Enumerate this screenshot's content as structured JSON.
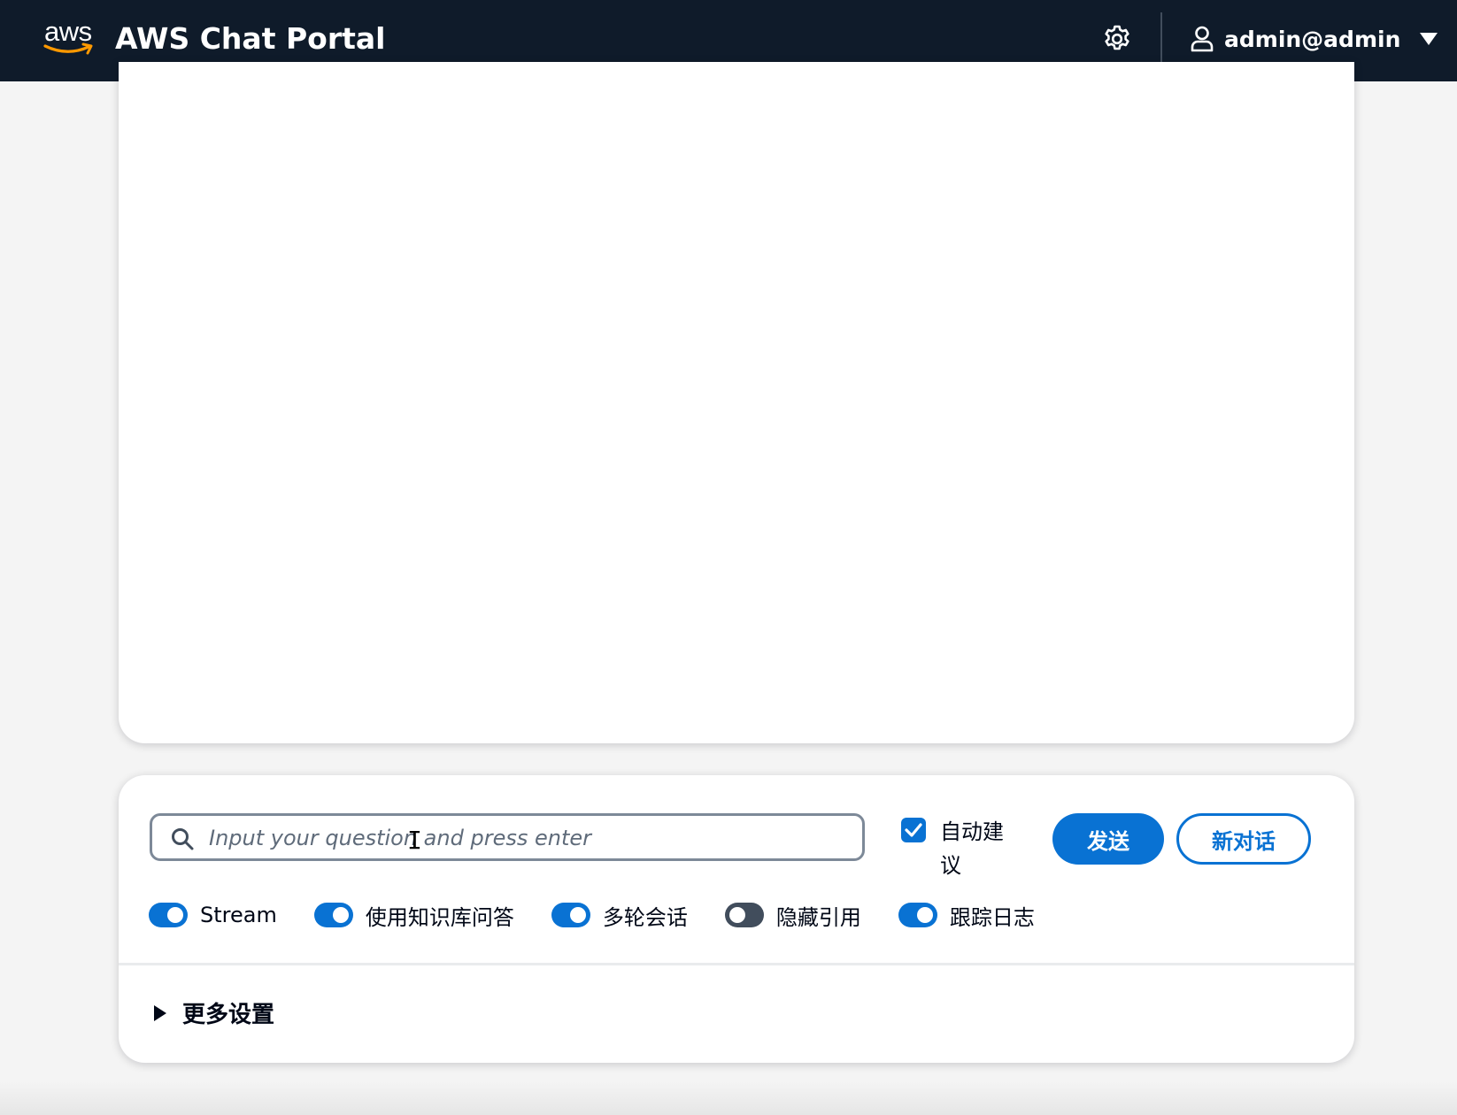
{
  "header": {
    "logo_text": "aws",
    "title": "AWS Chat Portal",
    "settings_icon": "gear-icon",
    "user_icon": "user-icon",
    "user_name": "admin@admin"
  },
  "colors": {
    "header_bg": "#0f1b2a",
    "accent": "#0972d3",
    "toggle_off": "#414d5c",
    "aws_smile": "#ff9900"
  },
  "chat": {
    "messages": []
  },
  "input": {
    "placeholder": "Input your question and press enter",
    "value": "",
    "auto_suggest_label": "自动建议",
    "auto_suggest_checked": true,
    "send_label": "发送",
    "new_chat_label": "新对话"
  },
  "toggles": [
    {
      "label": "Stream",
      "on": true
    },
    {
      "label": "使用知识库问答",
      "on": true
    },
    {
      "label": "多轮会话",
      "on": true
    },
    {
      "label": "隐藏引用",
      "on": false
    },
    {
      "label": "跟踪日志",
      "on": true
    }
  ],
  "more_settings": {
    "label": "更多设置",
    "expanded": false
  }
}
